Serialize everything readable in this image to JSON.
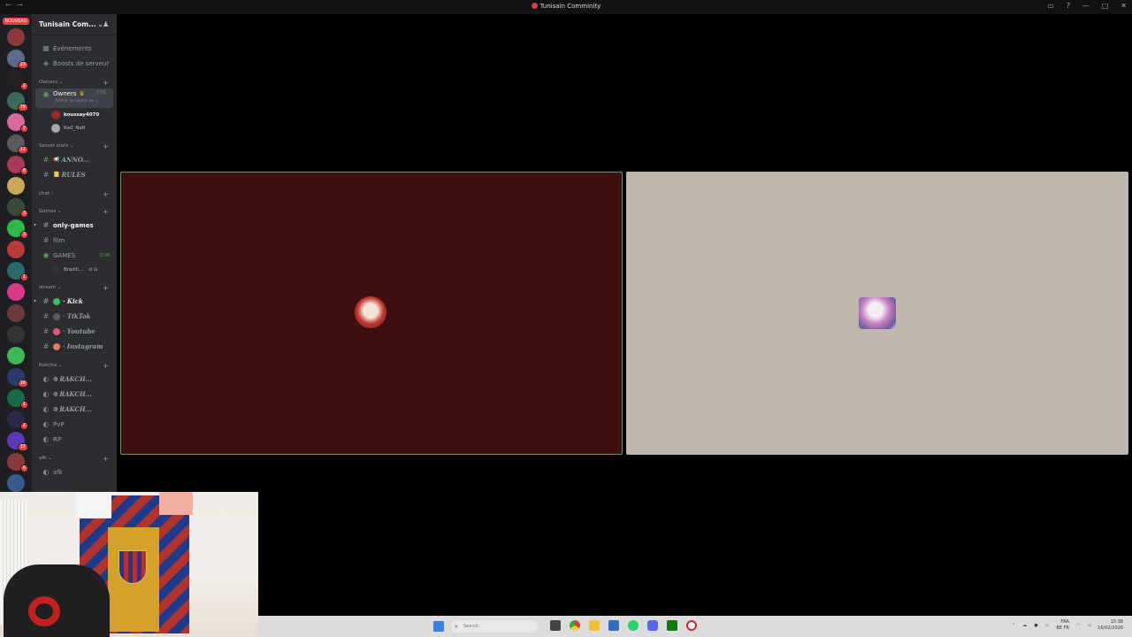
{
  "titlebar": {
    "title": "Tunisain Comminity",
    "nav": "← →"
  },
  "rail": {
    "new_label": "NOUVEAU",
    "servers": [
      {
        "color": "#8b3a3a",
        "badge": ""
      },
      {
        "color": "#5a6b8a",
        "badge": "23"
      },
      {
        "color": "#222222",
        "badge": "2"
      },
      {
        "color": "#3a6b5a",
        "badge": "79"
      },
      {
        "color": "#d86aa0",
        "badge": "7"
      },
      {
        "color": "#5a5a5a",
        "badge": "12"
      },
      {
        "color": "#a83a5a",
        "badge": "8"
      },
      {
        "color": "#c8a85a",
        "badge": ""
      },
      {
        "color": "#3a4a3a",
        "badge": "3"
      },
      {
        "color": "#2fb84a",
        "badge": "3"
      },
      {
        "color": "#b83a3a",
        "badge": ""
      },
      {
        "color": "#2a6a6a",
        "badge": "1"
      },
      {
        "color": "#d83a8a",
        "badge": ""
      },
      {
        "color": "#6a3a3a",
        "badge": ""
      },
      {
        "color": "#333333",
        "badge": ""
      },
      {
        "color": "#3ab85a",
        "badge": ""
      },
      {
        "color": "#2a3a6a",
        "badge": "16"
      },
      {
        "color": "#1a6a4a",
        "badge": "1"
      },
      {
        "color": "#2a2a4a",
        "badge": "2"
      },
      {
        "color": "#5a3ab8",
        "badge": "37"
      },
      {
        "color": "#8a3a3a",
        "badge": "6"
      },
      {
        "color": "#3a5a8a",
        "badge": ""
      }
    ]
  },
  "sidebar": {
    "guild_name": "Tunisain Com...",
    "top_items": [
      {
        "icon": "calendar-icon",
        "glyph": "▦",
        "label": "Événements"
      },
      {
        "icon": "boost-icon",
        "glyph": "◈",
        "label": "Boosts de serveur"
      }
    ],
    "categories": {
      "owners": "Owners",
      "server_stats": "Server stats",
      "chat": "chat",
      "games": "Games",
      "stream": "stream",
      "rakcha": "Rakcha",
      "afk": "afk"
    },
    "owners_channel": {
      "label": "Owners",
      "crown": "♛",
      "sub": "Définir un statut de ...",
      "time": "7:55"
    },
    "owners_users": [
      "koussay4070",
      "Ra0_NaR"
    ],
    "stats_channels": [
      {
        "prefix": "📢",
        "label": "ANNO..."
      },
      {
        "prefix": "📒",
        "label": "RULES"
      }
    ],
    "games_channels": [
      {
        "label": "only-games",
        "bright": true
      },
      {
        "label": "film",
        "bright": false
      }
    ],
    "games_voice": {
      "label": "GAMES",
      "time": "0:00"
    },
    "games_user": "Brazili...",
    "stream_channels": [
      {
        "label": "Kick",
        "color": "#39c35a",
        "bright": true
      },
      {
        "label": "TikTok",
        "color": "#5a5a5a",
        "bright": false
      },
      {
        "label": "Youtube",
        "color": "#e2557a",
        "bright": false
      },
      {
        "label": "Instagram",
        "color": "#e08060",
        "bright": false
      }
    ],
    "rakcha_voice": [
      "RAKCH...",
      "RAKCH...",
      "RAKCH..."
    ],
    "rakcha_plain": [
      "PvP",
      "RP"
    ],
    "afk_item": "afk"
  },
  "taskbar": {
    "search_placeholder": "Search",
    "lang": "FRA",
    "lang2": "BE FR",
    "time": "15:38",
    "date": "16/02/2026"
  },
  "colors": {
    "left_tile": "#3e0f10",
    "right_tile": "#bdb7ae",
    "speaking_border": "#5a9f5c"
  }
}
